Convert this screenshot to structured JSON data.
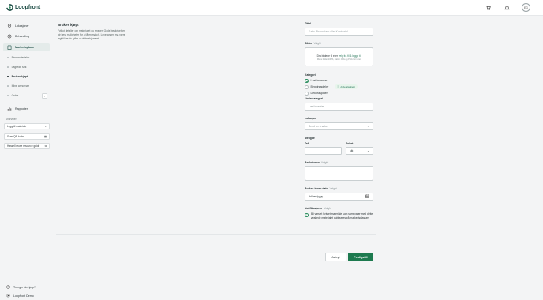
{
  "app": {
    "logo_text": "Loopfront",
    "avatar_initials": "EG"
  },
  "sidebar": {
    "nav": [
      {
        "label": "Lokasjoner"
      },
      {
        "label": "Behandling"
      },
      {
        "label": "Markedsplass"
      }
    ],
    "sub_items": [
      {
        "label": "Finn materialer"
      },
      {
        "label": "Lagrede søk"
      },
      {
        "label": "Brukes kjøpt"
      },
      {
        "label": "Mine annonser"
      },
      {
        "label": "Ordre"
      }
    ],
    "reports_label": "Rapporter",
    "shortcuts_title": "Snarveier",
    "shortcuts": [
      {
        "label": "Legg til materiale"
      },
      {
        "label": "Skan QR-kode"
      },
      {
        "label": "Hassell reuse resource guide"
      }
    ],
    "help_label": "Trenger du hjelp?",
    "org_label": "Loopfront Demo"
  },
  "form": {
    "title": "Brukes kjøpt",
    "description": "Fyll ut detaljer om materialet du ønsker. Gode beskrivelser gir best muligheter for å få en match. Leveransen må være lagt til før du fyller ut dette skjemaet.",
    "tittel_label": "Tittel",
    "tittel_placeholder": "F.eks. Brannsløer eller Kontorstol",
    "bilder_label": "Bilder",
    "optional": "Valgfri",
    "dropzone_main": "Dra bildene til eller ",
    "dropzone_link": "velg fra fil & legge til",
    "dropzone_sub": "Maks bilder 10Mb, støtter JPG og PNG formater",
    "kategori_label": "Kategori",
    "radios": [
      {
        "label": "Løst inventar",
        "checked": true
      },
      {
        "label": "Bygningsdeler",
        "checked": false
      },
      {
        "label": "Dekorasjoner",
        "checked": false
      }
    ],
    "badge_label": "Anbefalte kjøpt",
    "underkategori_label": "Underkategori",
    "underkategori_value": "Løst inventar",
    "lokasjon_label": "Lokasjon",
    "lokasjon_value": "Send for å søke",
    "mengde_label": "Mengde",
    "tall_label": "Tall",
    "enhet_label": "Enhet",
    "enhet_value": "stk",
    "beskrivelse_label": "Beskrivelse",
    "brukes_label": "Brukes innen dato",
    "date_placeholder": "dd/mm/yyyy",
    "notifikasjoner_label": "Notifikasjoner",
    "notifikasjon_text": "Bli varslet hvis et materiale som samsvarer med dette ønskede materialet publiseres på markedsplassen",
    "cancel_label": "Avbryt",
    "submit_label": "Ferdigstill"
  },
  "colors": {
    "accent": "#1d7a4f",
    "brand": "#1d4d45"
  }
}
